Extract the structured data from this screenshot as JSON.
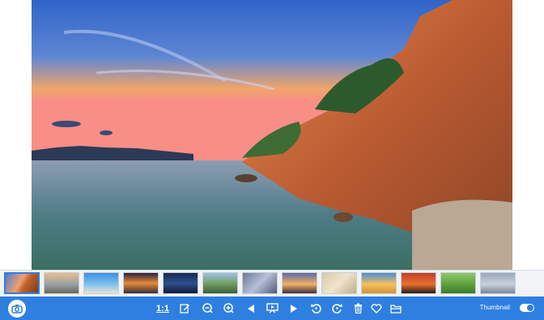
{
  "viewer": {
    "main_image": "coastal-sunset-cliffs"
  },
  "thumbnails": [
    {
      "name": "thumb-coastal-cliffs",
      "selected": true
    },
    {
      "name": "thumb-beach-sunset"
    },
    {
      "name": "thumb-palm-beach"
    },
    {
      "name": "thumb-sunset-sea"
    },
    {
      "name": "thumb-lightning"
    },
    {
      "name": "thumb-mountain-valley"
    },
    {
      "name": "thumb-aerial-city"
    },
    {
      "name": "thumb-desert-sunrise"
    },
    {
      "name": "thumb-sand-texture"
    },
    {
      "name": "thumb-golden-dunes"
    },
    {
      "name": "thumb-red-sunset-tree"
    },
    {
      "name": "thumb-green-field"
    },
    {
      "name": "thumb-cityscape"
    }
  ],
  "toolbar": {
    "actual_size_label": "1:1",
    "thumbnail_label": "Thumbnail",
    "thumbnail_toggle_on": true,
    "accent_color": "#2f7fe0",
    "icons": [
      "camera-icon",
      "edit-icon",
      "zoom-out-icon",
      "zoom-in-icon",
      "previous-icon",
      "slideshow-icon",
      "next-icon",
      "rotate-left-icon",
      "rotate-right-icon",
      "delete-icon",
      "favorite-icon",
      "open-folder-icon"
    ]
  }
}
